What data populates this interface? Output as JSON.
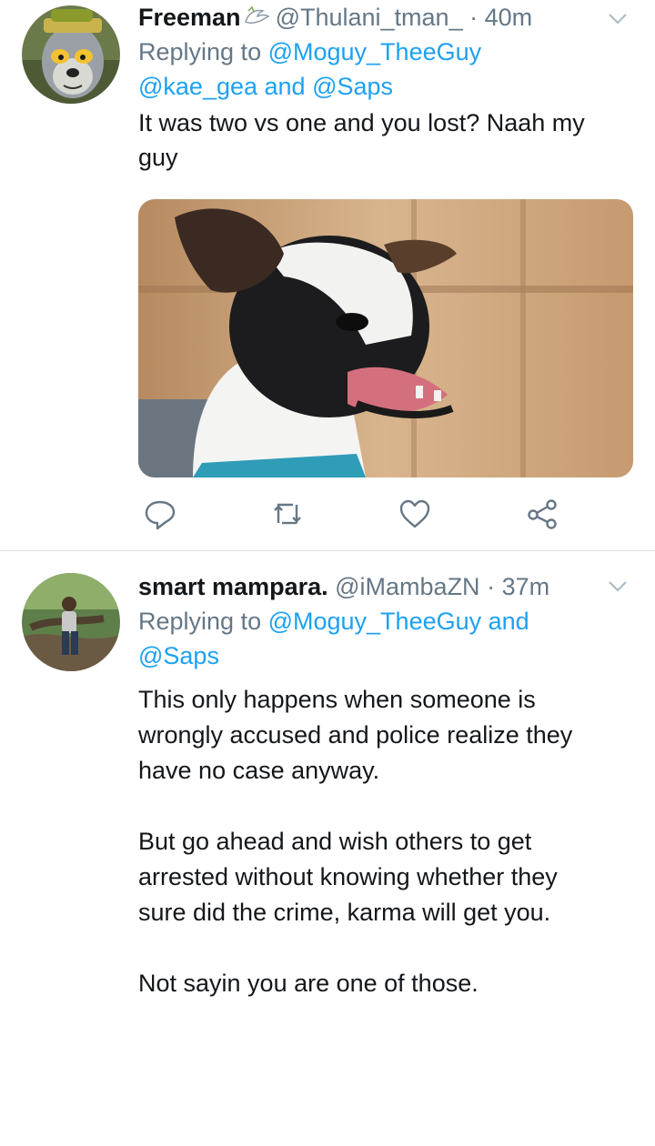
{
  "tweets": [
    {
      "display_name": "Freeman",
      "handle": "@Thulani_tman_",
      "dot": "·",
      "time": "40m",
      "replying_prefix": "Replying to ",
      "mentions_line1": "@Moguy_TheeGuy",
      "mentions_line2_a": "@kae_gea",
      "mentions_line2_and": " and ",
      "mentions_line2_b": "@Saps",
      "text": "It was two vs one and you lost? Naah my\nguy",
      "avatar_icon": "lemur-cartoon-avatar",
      "name_badge_icon": "dove-icon",
      "media_icon": "dog-photo"
    },
    {
      "display_name": "smart mampara.",
      "handle": "@iMambaZN",
      "dot": "·",
      "time": "37m",
      "replying_prefix": "Replying to ",
      "mentions_line1": "@Moguy_TheeGuy and",
      "mentions_line2": "@Saps",
      "text": "This only happens when someone is\nwrongly accused and police realize they\nhave no case anyway.\n\nBut go ahead and wish others to get\narrested without knowing whether they\nsure did the crime, karma will get you.\n\nNot sayin you are one of those.",
      "avatar_icon": "person-outdoors-avatar"
    }
  ],
  "actions": [
    "reply-icon",
    "retweet-icon",
    "like-icon",
    "share-icon"
  ],
  "colors": {
    "accent": "#1da1f2",
    "muted": "#657786",
    "text": "#14171a",
    "divider": "#d9dde1"
  }
}
